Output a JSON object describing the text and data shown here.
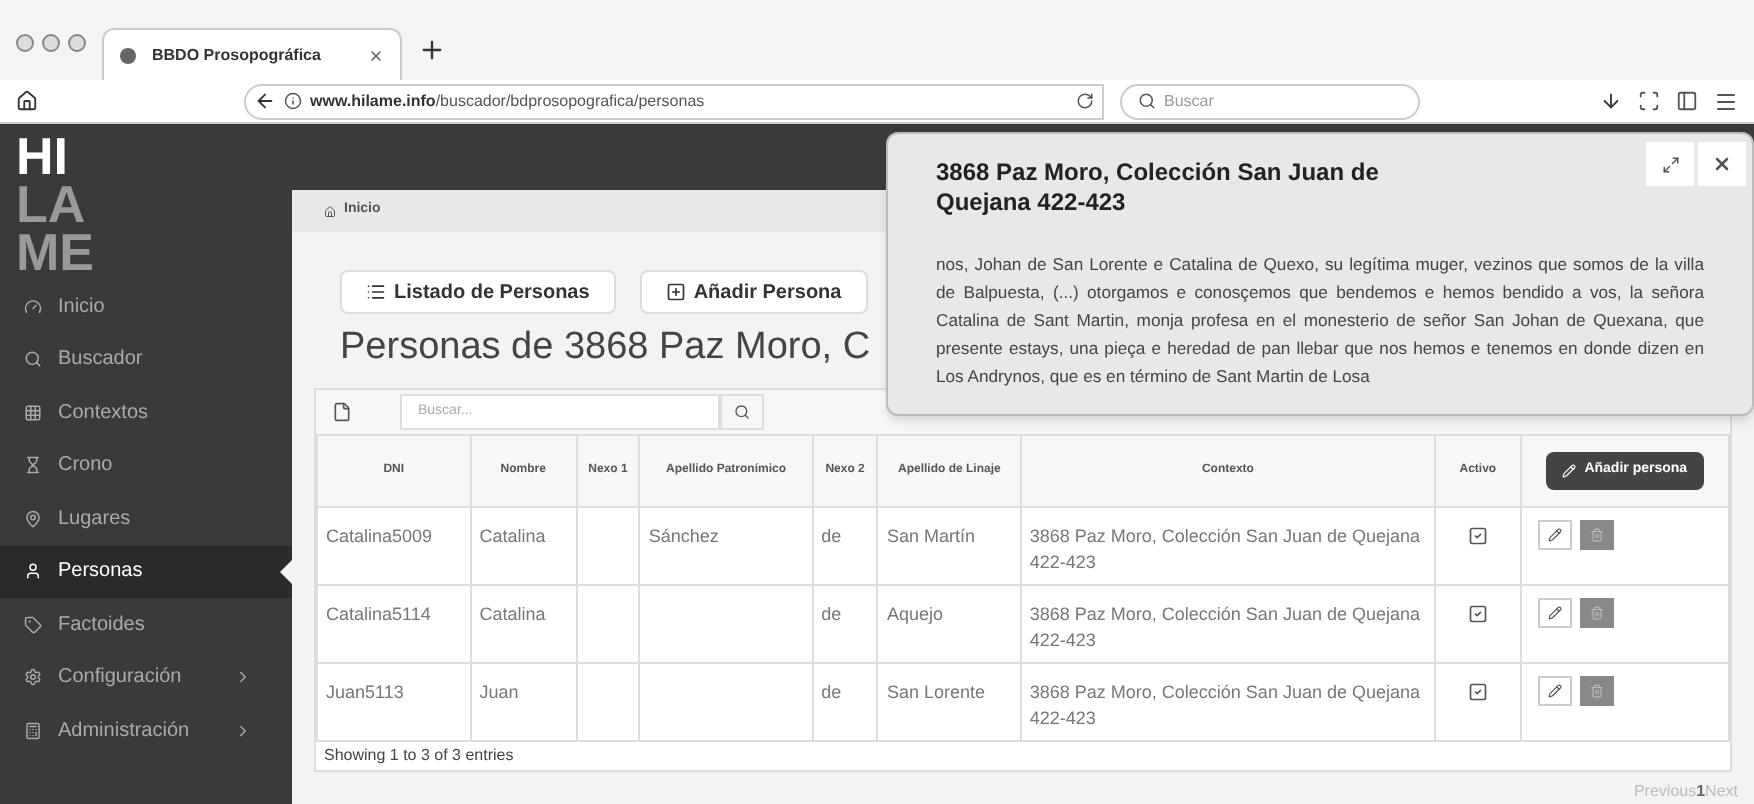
{
  "browser": {
    "tab_title": "BBDO Prosopográfica",
    "url_domain": "www.hilame.info",
    "url_path": "/buscador/bdprosopografica/personas",
    "search_placeholder": "Buscar"
  },
  "logo": [
    "HI",
    "LA",
    "ME"
  ],
  "sidebar": {
    "items": [
      {
        "label": "Inicio",
        "selected": false,
        "submenu": false
      },
      {
        "label": "Buscador",
        "selected": false,
        "submenu": false
      },
      {
        "label": "Contextos",
        "selected": false,
        "submenu": false
      },
      {
        "label": "Crono",
        "selected": false,
        "submenu": false
      },
      {
        "label": "Lugares",
        "selected": false,
        "submenu": false
      },
      {
        "label": "Personas",
        "selected": true,
        "submenu": false
      },
      {
        "label": "Factoides",
        "selected": false,
        "submenu": false
      },
      {
        "label": "Configuración",
        "selected": false,
        "submenu": true
      },
      {
        "label": "Administración",
        "selected": false,
        "submenu": true
      }
    ]
  },
  "breadcrumb": "Inicio",
  "buttons": [
    {
      "label": "Listado de Personas"
    },
    {
      "label": "Añadir Persona"
    }
  ],
  "heading": "Personas de 3868 Paz Moro, C",
  "table": {
    "search_placeholder": "Buscar...",
    "columns": [
      "DNI",
      "Nombre",
      "Nexo 1",
      "Apellido Patronímico",
      "Nexo 2",
      "Apellido de Linaje",
      "Contexto",
      "Activo"
    ],
    "add_button": "Añadir persona",
    "rows": [
      {
        "cells": [
          "Catalina5009",
          "Catalina",
          "",
          "Sánchez",
          "de",
          "San Martín",
          "3868 Paz Moro, Colección San Juan de Quejana 422-423"
        ],
        "activo": true
      },
      {
        "cells": [
          "Catalina5114",
          "Catalina",
          "",
          "",
          "de",
          "Aquejo",
          "3868 Paz Moro, Colección San Juan de Quejana 422-423"
        ],
        "activo": true
      },
      {
        "cells": [
          "Juan5113",
          "Juan",
          "",
          "",
          "de",
          "San Lorente",
          "3868 Paz Moro, Colección San Juan de Quejana 422-423"
        ],
        "activo": true
      }
    ],
    "footer": "Showing 1 to 3 of 3 entries",
    "pagination": [
      {
        "label": "Previous",
        "selected": false
      },
      {
        "label": "1",
        "selected": true
      },
      {
        "label": "Next",
        "selected": false
      }
    ]
  },
  "popup": {
    "title": "3868 Paz Moro, Colección San Juan de Quejana 422-423",
    "text": "nos, Johan de San Lorente e Catalina de Quexo, su legítima muger, vezinos que somos de la villa de Balpuesta, (...) otorgamos e conosçemos que bendemos e hemos bendido a vos, la señora Catalina de Sant Martin, monja profesa en el monesterio de señor San Johan de Quexana, que presente estays, una pieça e heredad de pan llebar que nos hemos e tenemos en donde dizen en Los Andrynos, que es en término de Sant Martin de Losa"
  }
}
